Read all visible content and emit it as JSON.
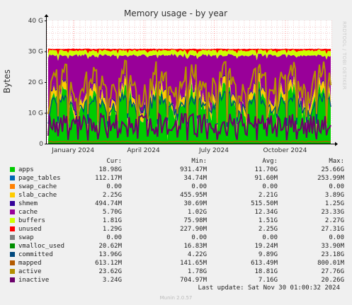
{
  "chart_data": {
    "type": "area",
    "title": "Memory usage - by year",
    "ylabel": "Bytes",
    "side_text": "RRDTOOL / TOBI OETIKER",
    "y_unit": "bytes",
    "ylim": [
      0,
      40000000000
    ],
    "y_ticks": [
      {
        "value": 0,
        "label": "0"
      },
      {
        "value": 10000000000,
        "label": "10 G"
      },
      {
        "value": 20000000000,
        "label": "20 G"
      },
      {
        "value": 30000000000,
        "label": "30 G"
      },
      {
        "value": 40000000000,
        "label": "40 G"
      }
    ],
    "x_range": [
      "2023-11-28",
      "2024-11-30"
    ],
    "x_ticks": [
      {
        "date": "2024-01-01",
        "label": "January 2024"
      },
      {
        "date": "2024-04-01",
        "label": "April 2024"
      },
      {
        "date": "2024-07-01",
        "label": "July 2024"
      },
      {
        "date": "2024-10-01",
        "label": "October 2024"
      }
    ],
    "columns": [
      "Cur:",
      "Min:",
      "Avg:",
      "Max:"
    ],
    "series": [
      {
        "name": "apps",
        "color": "#00cc00",
        "kind": "stack",
        "avg": 11.7,
        "cur": "18.98G",
        "min": "931.47M",
        "avgText": "11.70G",
        "max": "25.66G"
      },
      {
        "name": "page_tables",
        "color": "#0066b3",
        "kind": "stack",
        "avg": 0.092,
        "cur": "112.17M",
        "min": "34.74M",
        "avgText": "91.60M",
        "max": "253.99M"
      },
      {
        "name": "swap_cache",
        "color": "#ff8000",
        "kind": "stack",
        "avg": 0,
        "cur": "0.00",
        "min": "0.00",
        "avgText": "0.00",
        "max": "0.00"
      },
      {
        "name": "slab_cache",
        "color": "#ffcc00",
        "kind": "stack",
        "avg": 2.21,
        "cur": "2.25G",
        "min": "455.95M",
        "avgText": "2.21G",
        "max": "3.89G"
      },
      {
        "name": "shmem",
        "color": "#330099",
        "kind": "stack",
        "avg": 0.515,
        "cur": "494.74M",
        "min": "30.69M",
        "avgText": "515.50M",
        "max": "1.25G"
      },
      {
        "name": "cache",
        "color": "#990099",
        "kind": "stack",
        "avg": 12.34,
        "cur": "5.70G",
        "min": "1.02G",
        "avgText": "12.34G",
        "max": "23.33G"
      },
      {
        "name": "buffers",
        "color": "#ccff00",
        "kind": "stack",
        "avg": 1.51,
        "cur": "1.81G",
        "min": "75.98M",
        "avgText": "1.51G",
        "max": "2.27G"
      },
      {
        "name": "unused",
        "color": "#ff0000",
        "kind": "stack",
        "avg": 2.25,
        "cur": "1.29G",
        "min": "227.90M",
        "avgText": "2.25G",
        "max": "27.31G"
      },
      {
        "name": "swap",
        "color": "#808080",
        "kind": "stack",
        "avg": 0,
        "cur": "0.00",
        "min": "0.00",
        "avgText": "0.00",
        "max": "0.00"
      },
      {
        "name": "vmalloc_used",
        "color": "#008f00",
        "kind": "line",
        "avg": 0.019,
        "cur": "20.62M",
        "min": "16.83M",
        "avgText": "19.24M",
        "max": "33.90M"
      },
      {
        "name": "committed",
        "color": "#00487d",
        "kind": "line",
        "avg": 9.89,
        "cur": "13.96G",
        "min": "4.22G",
        "avgText": "9.89G",
        "max": "23.18G"
      },
      {
        "name": "mapped",
        "color": "#b35a00",
        "kind": "line",
        "avg": 0.613,
        "cur": "613.12M",
        "min": "141.65M",
        "avgText": "613.49M",
        "max": "800.01M"
      },
      {
        "name": "active",
        "color": "#b38f00",
        "kind": "line",
        "avg": 18.81,
        "cur": "23.62G",
        "min": "1.78G",
        "avgText": "18.81G",
        "max": "27.76G"
      },
      {
        "name": "inactive",
        "color": "#6b006b",
        "kind": "line",
        "avg": 7.16,
        "cur": "3.24G",
        "min": "704.97M",
        "avgText": "7.16G",
        "max": "20.26G"
      }
    ],
    "last_update": "Last update: Sat Nov 30 01:00:32 2024",
    "footer": "Munin 2.0.57"
  }
}
